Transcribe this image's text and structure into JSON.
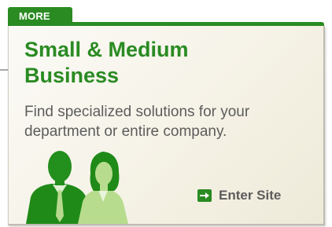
{
  "tab": {
    "label": "MORE"
  },
  "card": {
    "title_line1": "Small & Medium",
    "title_line2": "Business",
    "description_line1": "Find specialized solutions for your",
    "description_line2": "department or entire company.",
    "link_label": "Enter Site",
    "link_icon": "arrow-right-icon"
  },
  "colors": {
    "brand_green": "#2a8b22",
    "text_gray": "#5c5c5c",
    "card_background": "#f5f2e6",
    "figure_green": "#1f8a18"
  }
}
